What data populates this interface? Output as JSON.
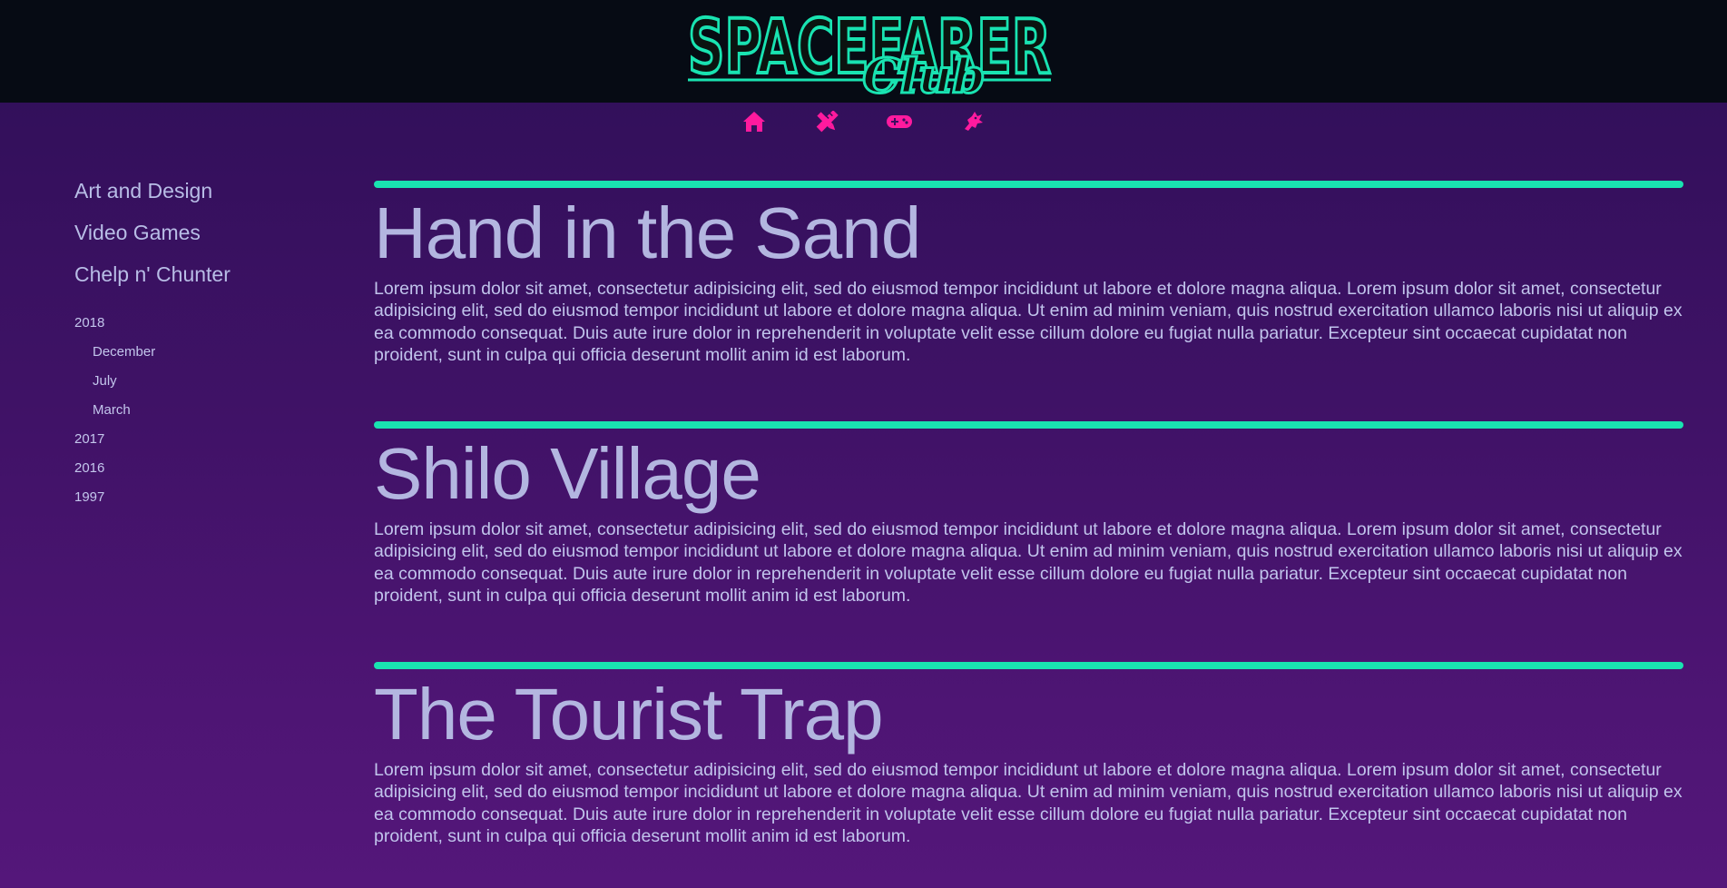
{
  "header": {
    "logo": {
      "wordmark": "SPACEFARER",
      "script": "Club"
    }
  },
  "nav": {
    "icons": [
      {
        "icon": "home-icon"
      },
      {
        "icon": "pencil-ruler-icon"
      },
      {
        "icon": "gamepad-icon"
      },
      {
        "icon": "dragon-icon"
      }
    ],
    "accent": "#ff1a9e"
  },
  "sidebar": {
    "categories": [
      {
        "label": "Art and Design"
      },
      {
        "label": "Video Games"
      },
      {
        "label": "Chelp n' Chunter"
      }
    ],
    "archive": {
      "expanded_year": "2018",
      "months": [
        "December",
        "July",
        "March"
      ],
      "other_years": [
        "2017",
        "2016",
        "1997"
      ]
    }
  },
  "posts": [
    {
      "title": "Hand in the Sand",
      "body": "Lorem ipsum dolor sit amet, consectetur adipisicing elit, sed do eiusmod tempor incididunt ut labore et dolore magna aliqua. Lorem ipsum dolor sit amet, consectetur adipisicing elit, sed do eiusmod tempor incididunt ut labore et dolore magna aliqua. Ut enim ad minim veniam, quis nostrud exercitation ullamco laboris nisi ut aliquip ex ea commodo consequat. Duis aute irure dolor in reprehenderit in voluptate velit esse cillum dolore eu fugiat nulla pariatur. Excepteur sint occaecat cupidatat non proident, sunt in culpa qui officia deserunt mollit anim id est laborum."
    },
    {
      "title": "Shilo Village",
      "body": "Lorem ipsum dolor sit amet, consectetur adipisicing elit, sed do eiusmod tempor incididunt ut labore et dolore magna aliqua. Lorem ipsum dolor sit amet, consectetur adipisicing elit, sed do eiusmod tempor incididunt ut labore et dolore magna aliqua. Ut enim ad minim veniam, quis nostrud exercitation ullamco laboris nisi ut aliquip ex ea commodo consequat. Duis aute irure dolor in reprehenderit in voluptate velit esse cillum dolore eu fugiat nulla pariatur. Excepteur sint occaecat cupidatat non proident, sunt in culpa qui officia deserunt mollit anim id est laborum."
    },
    {
      "title": "The Tourist Trap",
      "body": "Lorem ipsum dolor sit amet, consectetur adipisicing elit, sed do eiusmod tempor incididunt ut labore et dolore magna aliqua. Lorem ipsum dolor sit amet, consectetur adipisicing elit, sed do eiusmod tempor incididunt ut labore et dolore magna aliqua. Ut enim ad minim veniam, quis nostrud exercitation ullamco laboris nisi ut aliquip ex ea commodo consequat. Duis aute irure dolor in reprehenderit in voluptate velit esse cillum dolore eu fugiat nulla pariatur. Excepteur sint occaecat cupidatat non proident, sunt in culpa qui officia deserunt mollit anim id est laborum."
    }
  ],
  "colors": {
    "accent_green": "#19e3b1",
    "accent_pink": "#ff1a9e",
    "header_bg": "#060b14",
    "text": "#b3b6e0"
  }
}
